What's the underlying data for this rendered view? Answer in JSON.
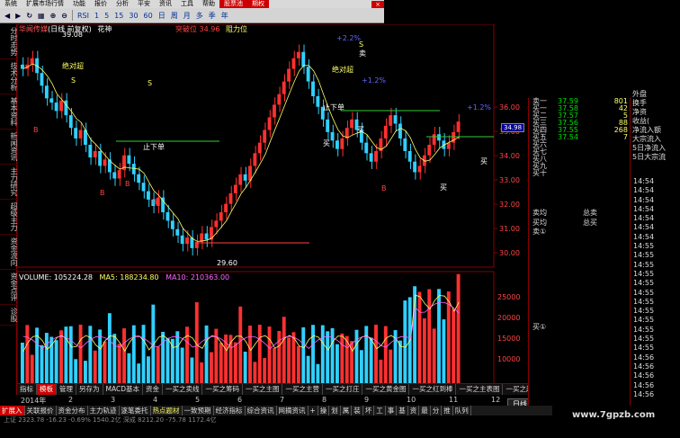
{
  "menu": {
    "items": [
      "系统",
      "扩展市场行情",
      "功能",
      "报价",
      "分析",
      "平安",
      "资讯",
      "工具",
      "帮助"
    ],
    "highlight_items": [
      "股票池",
      "期权"
    ]
  },
  "toolbar": {
    "items": [
      "RSI",
      "1",
      "5",
      "15",
      "30",
      "60",
      "日",
      "周",
      "月",
      "多",
      "季",
      "年"
    ]
  },
  "left_tabs": [
    "分时走势",
    "技术分析",
    "基本资料",
    "新闻资讯",
    "主力研究",
    "超级主力",
    "资金流向",
    "资金点评",
    "诊股"
  ],
  "chart": {
    "stock_name": "华闻传媒",
    "stock_info": "(日线 前复权)",
    "indicator": "花神",
    "price_label_a": "突破位",
    "price_value_a": "34.96",
    "price_label_b": "阻力位",
    "high_label": "39.08",
    "low_label": "29.60",
    "box_price": "34.98",
    "pct1": "+2.2%",
    "pct2": "+1.2%",
    "pct3": "+1.2%",
    "sig_top": "绝对超",
    "sig_mid": "止下单",
    "signal_buy": "买",
    "signal_sell": "卖",
    "volume_label": "VOLUME: 105224.28",
    "ma5_label": "MA5: 188234.80",
    "ma10_label": "MA10: 210363.00",
    "y_labels": [
      "36.00",
      "35.00",
      "34.00",
      "33.00",
      "32.00",
      "31.00",
      "30.00"
    ],
    "vol_labels": [
      "25000",
      "20000",
      "15000",
      "10000"
    ],
    "vol_unit": "X10"
  },
  "date_axis": {
    "labels": [
      "2014年",
      "2",
      "3",
      "4",
      "5",
      "6",
      "7",
      "8",
      "9",
      "10",
      "11",
      "12"
    ],
    "day_tab": "日线"
  },
  "tabs_row1": [
    "指标",
    "模板",
    "管理",
    "另存为",
    "MACD基本",
    "资金",
    "一买之卖线",
    "一买之筹码",
    "一买之主图",
    "一买之主营",
    "一买之打庄",
    "一买之黄金图",
    "一买之红到棒",
    "一买之主表图",
    "一买之趋势",
    "一买之买天图"
  ],
  "tabs_row2": [
    "扩展入",
    "关联报价",
    "资金分布",
    "主力轨迹",
    "逐笔委托",
    "热点题材",
    "一致预期",
    "经济指标",
    "综合资讯",
    "网摘资讯",
    "+",
    "操",
    "划",
    "属",
    "装",
    "坏",
    "工",
    "事",
    "基",
    "资",
    "最",
    "分",
    "推",
    "队列"
  ],
  "status": "上证 2323.78 -16.23 -0.69%  1540.2亿  深成 8212.20 -75.78  1172.4亿",
  "orderbook": {
    "sells": [
      {
        "label": "卖一",
        "price": "37.59",
        "vol": "801"
      },
      {
        "label": "买一",
        "price": "37.58",
        "vol": "42"
      },
      {
        "label": "买二",
        "price": "37.57",
        "vol": "5"
      },
      {
        "label": "买三",
        "price": "37.56",
        "vol": "88"
      },
      {
        "label": "买四",
        "price": "37.55",
        "vol": "268"
      },
      {
        "label": "买五",
        "price": "37.54",
        "vol": "7"
      }
    ],
    "extra": [
      "买六",
      "买七",
      "买八",
      "买九",
      "买十"
    ],
    "summary": [
      {
        "label": "卖均",
        "value": "总卖"
      },
      {
        "label": "买均",
        "value": "总买"
      }
    ],
    "sell1_label": "卖①",
    "buy1_label": "买①"
  },
  "fin_labels": [
    "外盘",
    "换手",
    "净资",
    "收益(",
    "净流入额",
    "大宗流入",
    "5日净流入",
    "5日大宗流"
  ],
  "ticks": [
    "14:54",
    "14:54",
    "14:54",
    "14:54",
    "14:54",
    "14:54",
    "14:54",
    "14:55",
    "14:55",
    "14:55",
    "14:55",
    "14:55",
    "14:55",
    "14:55",
    "14:55",
    "14:55",
    "14:55",
    "14:55",
    "14:55",
    "14:56",
    "14:56",
    "14:56",
    "14:56",
    "14:56",
    "14:56",
    "14:56",
    "14:56",
    "14:56",
    "14:56",
    "14:56",
    "14:56"
  ],
  "watermark": "www.7gpzb.com",
  "colors": {
    "up": "#ff3030",
    "down": "#30d0ff",
    "ma5": "#ffff66",
    "ma10": "#ff66ff",
    "accent": "#cc0000"
  }
}
